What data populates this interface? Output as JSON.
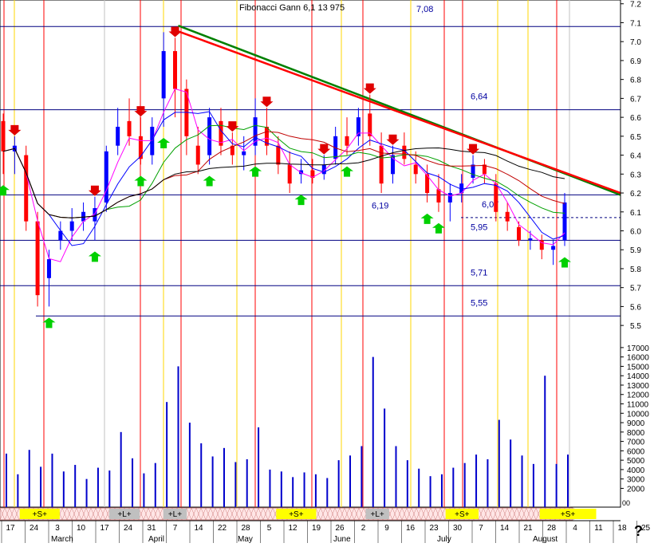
{
  "title": "Fibonacci Gann 6,1 13 975",
  "help_symbol": "?",
  "chart_data": {
    "type": "candlestick",
    "price_axis": {
      "ticks": [
        "7.2",
        "7.1",
        "7.0",
        "6.9",
        "6.8",
        "6.7",
        "6.6",
        "6.5",
        "6.4",
        "6.3",
        "6.2",
        "6.1",
        "6.0",
        "5.9",
        "5.8",
        "5.7",
        "5.6",
        "5.5"
      ],
      "ylim": [
        5.45,
        7.22
      ]
    },
    "volume_axis": {
      "ticks": [
        "17000",
        "16000",
        "15000",
        "14000",
        "13000",
        "12000",
        "11000",
        "10000",
        "9000",
        "8000",
        "7000",
        "6000",
        "5000",
        "4000",
        "3000",
        "2000"
      ],
      "ylim": [
        0,
        17500
      ],
      "unit_label": "00"
    },
    "x_axis": {
      "day_labels": [
        "17",
        "24",
        "3",
        "10",
        "17",
        "24",
        "31",
        "7",
        "14",
        "22",
        "28",
        "5",
        "12",
        "19",
        "26",
        "2",
        "9",
        "16",
        "23",
        "30",
        "7",
        "14",
        "21",
        "28",
        "4",
        "11",
        "18",
        "25"
      ],
      "month_labels": [
        "March",
        "April",
        "May",
        "June",
        "July",
        "August"
      ]
    },
    "level_lines": [
      {
        "label": "7,08",
        "value": 7.08
      },
      {
        "label": "6,64",
        "value": 6.64
      },
      {
        "label": "6,19",
        "value": 6.19
      },
      {
        "label": "6,07",
        "value": 6.07
      },
      {
        "label": "5,95",
        "value": 5.95
      },
      {
        "label": "5,71",
        "value": 5.71
      },
      {
        "label": "5,55",
        "value": 5.55
      }
    ],
    "trendlines": [
      {
        "name": "",
        "color": "#008000",
        "from": [
          7,
          7.08
        ],
        "to": [
          27.7,
          6.19
        ]
      },
      {
        "name": "",
        "color": "#ff0000",
        "from": [
          7,
          7.05
        ],
        "to": [
          27.7,
          6.2
        ]
      }
    ],
    "signal_bars": [
      {
        "label": "+S+",
        "from": 0.5,
        "to": 2.2,
        "color": "#ffff00"
      },
      {
        "label": "+L+",
        "from": 4.3,
        "to": 5.6,
        "color": "#c0c0c0"
      },
      {
        "label": "+L+",
        "from": 6.6,
        "to": 7.6,
        "color": "#c0c0c0"
      },
      {
        "label": "+S+",
        "from": 11.4,
        "to": 13.1,
        "color": "#ffff00"
      },
      {
        "label": "+L+",
        "from": 15.2,
        "to": 16.2,
        "color": "#c0c0c0"
      },
      {
        "label": "+S+",
        "from": 18.6,
        "to": 20.0,
        "color": "#ffff00"
      },
      {
        "label": "+S+",
        "from": 22.6,
        "to": 25.0,
        "color": "#ffff00"
      }
    ],
    "candles": [
      {
        "o": 6.58,
        "h": 6.62,
        "l": 6.3,
        "c": 6.42
      },
      {
        "o": 6.42,
        "h": 6.5,
        "l": 6.3,
        "c": 6.45
      },
      {
        "o": 6.4,
        "h": 6.45,
        "l": 6.0,
        "c": 6.05
      },
      {
        "o": 6.05,
        "h": 6.1,
        "l": 5.6,
        "c": 5.66
      },
      {
        "o": 5.75,
        "h": 5.9,
        "l": 5.6,
        "c": 5.85
      },
      {
        "o": 5.95,
        "h": 6.05,
        "l": 5.9,
        "c": 6.0
      },
      {
        "o": 6.0,
        "h": 6.12,
        "l": 5.95,
        "c": 6.05
      },
      {
        "o": 6.05,
        "h": 6.15,
        "l": 6.0,
        "c": 6.1
      },
      {
        "o": 6.05,
        "h": 6.18,
        "l": 5.95,
        "c": 6.12
      },
      {
        "o": 6.15,
        "h": 6.45,
        "l": 6.1,
        "c": 6.42
      },
      {
        "o": 6.45,
        "h": 6.65,
        "l": 6.4,
        "c": 6.55
      },
      {
        "o": 6.58,
        "h": 6.7,
        "l": 6.45,
        "c": 6.5
      },
      {
        "o": 6.5,
        "h": 6.6,
        "l": 6.35,
        "c": 6.38
      },
      {
        "o": 6.4,
        "h": 6.6,
        "l": 6.35,
        "c": 6.55
      },
      {
        "o": 6.7,
        "h": 7.05,
        "l": 6.55,
        "c": 6.95
      },
      {
        "o": 6.95,
        "h": 7.02,
        "l": 6.6,
        "c": 6.75
      },
      {
        "o": 6.75,
        "h": 6.8,
        "l": 6.4,
        "c": 6.5
      },
      {
        "o": 6.45,
        "h": 6.55,
        "l": 6.3,
        "c": 6.35
      },
      {
        "o": 6.4,
        "h": 6.65,
        "l": 6.35,
        "c": 6.6
      },
      {
        "o": 6.58,
        "h": 6.65,
        "l": 6.4,
        "c": 6.45
      },
      {
        "o": 6.45,
        "h": 6.52,
        "l": 6.35,
        "c": 6.4
      },
      {
        "o": 6.4,
        "h": 6.5,
        "l": 6.32,
        "c": 6.42
      },
      {
        "o": 6.45,
        "h": 6.7,
        "l": 6.4,
        "c": 6.6
      },
      {
        "o": 6.55,
        "h": 6.65,
        "l": 6.4,
        "c": 6.45
      },
      {
        "o": 6.45,
        "h": 6.5,
        "l": 6.3,
        "c": 6.35
      },
      {
        "o": 6.35,
        "h": 6.42,
        "l": 6.2,
        "c": 6.25
      },
      {
        "o": 6.3,
        "h": 6.38,
        "l": 6.25,
        "c": 6.32
      },
      {
        "o": 6.32,
        "h": 6.38,
        "l": 6.25,
        "c": 6.28
      },
      {
        "o": 6.3,
        "h": 6.4,
        "l": 6.27,
        "c": 6.35
      },
      {
        "o": 6.38,
        "h": 6.55,
        "l": 6.35,
        "c": 6.5
      },
      {
        "o": 6.5,
        "h": 6.6,
        "l": 6.4,
        "c": 6.45
      },
      {
        "o": 6.5,
        "h": 6.65,
        "l": 6.45,
        "c": 6.6
      },
      {
        "o": 6.62,
        "h": 6.72,
        "l": 6.45,
        "c": 6.5
      },
      {
        "o": 6.45,
        "h": 6.52,
        "l": 6.2,
        "c": 6.25
      },
      {
        "o": 6.3,
        "h": 6.45,
        "l": 6.25,
        "c": 6.4
      },
      {
        "o": 6.45,
        "h": 6.52,
        "l": 6.35,
        "c": 6.38
      },
      {
        "o": 6.35,
        "h": 6.42,
        "l": 6.25,
        "c": 6.3
      },
      {
        "o": 6.3,
        "h": 6.35,
        "l": 6.15,
        "c": 6.2
      },
      {
        "o": 6.22,
        "h": 6.3,
        "l": 6.1,
        "c": 6.15
      },
      {
        "o": 6.15,
        "h": 6.25,
        "l": 6.05,
        "c": 6.2
      },
      {
        "o": 6.2,
        "h": 6.3,
        "l": 6.15,
        "c": 6.25
      },
      {
        "o": 6.28,
        "h": 6.4,
        "l": 6.25,
        "c": 6.35
      },
      {
        "o": 6.35,
        "h": 6.38,
        "l": 6.25,
        "c": 6.3
      },
      {
        "o": 6.25,
        "h": 6.3,
        "l": 6.05,
        "c": 6.1
      },
      {
        "o": 6.1,
        "h": 6.15,
        "l": 6.0,
        "c": 6.05
      },
      {
        "o": 6.02,
        "h": 6.05,
        "l": 5.92,
        "c": 5.95
      },
      {
        "o": 5.95,
        "h": 6.0,
        "l": 5.9,
        "c": 5.96
      },
      {
        "o": 5.95,
        "h": 5.98,
        "l": 5.85,
        "c": 5.9
      },
      {
        "o": 5.9,
        "h": 5.95,
        "l": 5.82,
        "c": 5.92
      },
      {
        "o": 5.95,
        "h": 6.2,
        "l": 5.92,
        "c": 6.15
      }
    ],
    "volumes": [
      5700,
      3500,
      6100,
      4300,
      5700,
      3800,
      4500,
      3000,
      4200,
      3900,
      8000,
      5200,
      3600,
      4700,
      11200,
      15000,
      9000,
      6800,
      5400,
      6300,
      4800,
      5100,
      8500,
      4000,
      3800,
      3200,
      3700,
      3500,
      3100,
      5000,
      5500,
      6500,
      16000,
      10500,
      6500,
      5000,
      4100,
      3300,
      3500,
      4200,
      4700,
      5600,
      5100,
      9300,
      7200,
      5500,
      4600,
      14000,
      4600,
      5600
    ]
  }
}
